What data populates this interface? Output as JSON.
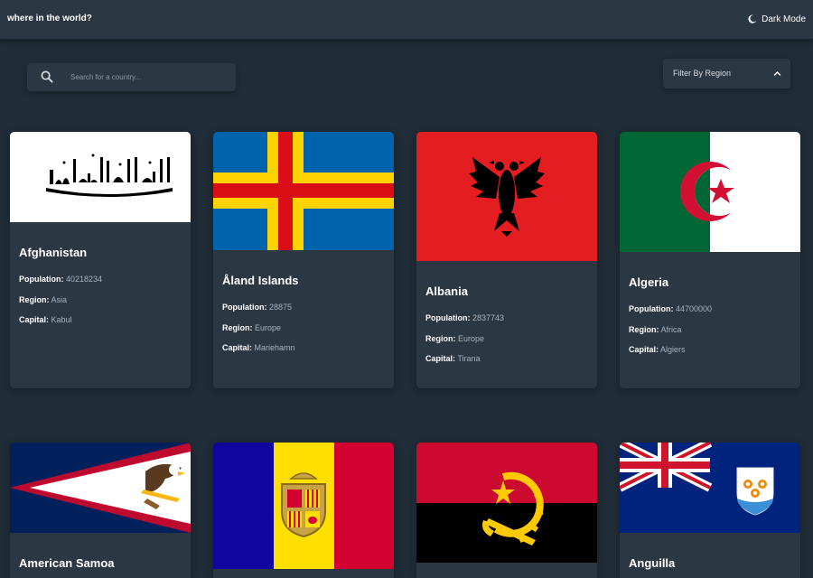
{
  "header": {
    "title": "where in the world?",
    "theme_toggle_label": "Dark Mode"
  },
  "search": {
    "placeholder": "Search for a country...",
    "value": ""
  },
  "filter": {
    "label": "Filter By Region"
  },
  "labels": {
    "population": "Population:",
    "region": "Region:",
    "capital": "Capital:"
  },
  "countries": [
    {
      "name": "Afghanistan",
      "population": "40218234",
      "region": "Asia",
      "capital": "Kabul"
    },
    {
      "name": "Åland Islands",
      "population": "28875",
      "region": "Europe",
      "capital": "Mariehamn"
    },
    {
      "name": "Albania",
      "population": "2837743",
      "region": "Europe",
      "capital": "Tirana"
    },
    {
      "name": "Algeria",
      "population": "44700000",
      "region": "Africa",
      "capital": "Algiers"
    },
    {
      "name": "American Samoa"
    },
    {
      "name": ""
    },
    {
      "name": ""
    },
    {
      "name": "Anguilla"
    }
  ],
  "colors": {
    "background": "#202c37",
    "element": "#2b3743",
    "text": "#ffffff"
  }
}
